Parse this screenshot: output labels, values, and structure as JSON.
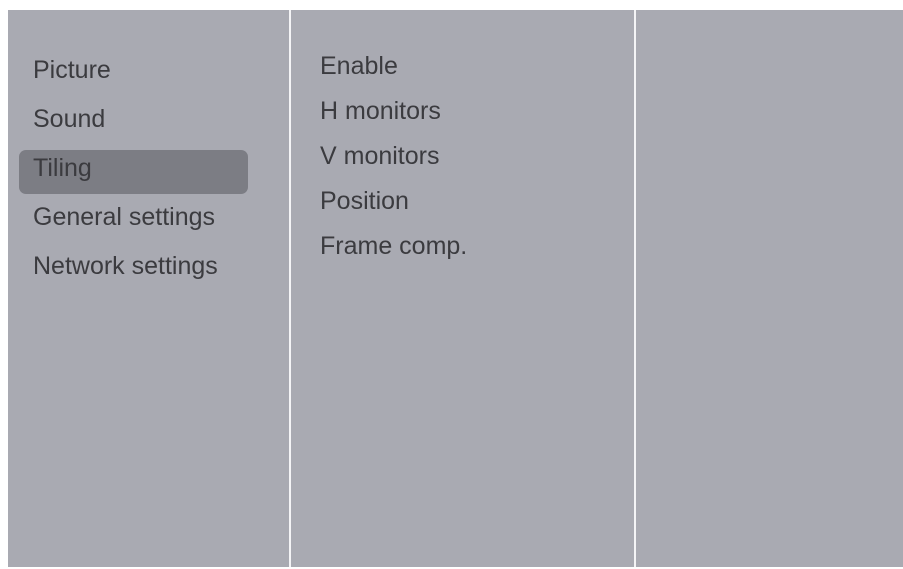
{
  "main_menu": {
    "items": [
      {
        "label": "Picture"
      },
      {
        "label": "Sound"
      },
      {
        "label": "Tiling",
        "selected": true
      },
      {
        "label": "General settings"
      },
      {
        "label": "Network settings"
      }
    ]
  },
  "sub_menu": {
    "items": [
      {
        "label": "Enable"
      },
      {
        "label": "H monitors"
      },
      {
        "label": "V monitors"
      },
      {
        "label": "Position"
      },
      {
        "label": "Frame comp."
      }
    ]
  },
  "colors": {
    "panel_background": "#a9aab2",
    "selection_highlight": "#7c7d84",
    "divider": "#f4f4f6",
    "text": "#3b3b3f"
  }
}
